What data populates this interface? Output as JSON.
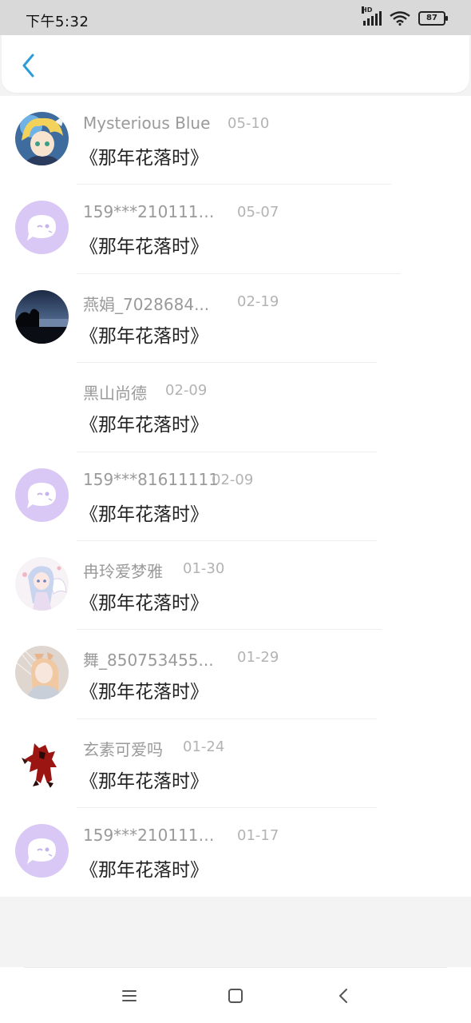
{
  "status_bar": {
    "time": "下午5:32",
    "network_label": "HD",
    "battery": "87"
  },
  "header": {
    "back_icon": "chevron-left-icon"
  },
  "colors": {
    "accent": "#2d9cdb",
    "name_gray": "#9a9a9a",
    "date_gray": "#b3b3b3",
    "default_avatar_bg": "#d9c8f5"
  },
  "messages": [
    {
      "name": "Mysterious Blue",
      "date": "05-10",
      "title": "《那年花落时》",
      "avatar": "anime-blonde-avatar"
    },
    {
      "name": "159***21011111...",
      "date": "05-07",
      "title": "《那年花落时》",
      "avatar": "default-chat-avatar"
    },
    {
      "name": "燕娟_7028684...",
      "date": "02-19",
      "title": "《那年花落时》",
      "avatar": "night-lake-avatar"
    },
    {
      "name": "黑山尚德",
      "date": "02-09",
      "title": "《那年花落时》",
      "avatar": "blank-avatar"
    },
    {
      "name": "159***81611111",
      "date": "02-09",
      "title": "《那年花落时》",
      "avatar": "default-chat-avatar"
    },
    {
      "name": "冉玲爱梦雅",
      "date": "01-30",
      "title": "《那年花落时》",
      "avatar": "anime-angel-avatar"
    },
    {
      "name": "舞_850753455...",
      "date": "01-29",
      "title": "《那年花落时》",
      "avatar": "cosplay-avatar"
    },
    {
      "name": "玄素可爱吗",
      "date": "01-24",
      "title": "《那年花落时》",
      "avatar": "red-robot-avatar"
    },
    {
      "name": "159***21011111...",
      "date": "01-17",
      "title": "《那年花落时》",
      "avatar": "default-chat-avatar"
    }
  ],
  "nav_bar": {
    "menu_icon": "menu-icon",
    "home_icon": "home-square-icon",
    "back_icon": "back-triangle-icon"
  }
}
